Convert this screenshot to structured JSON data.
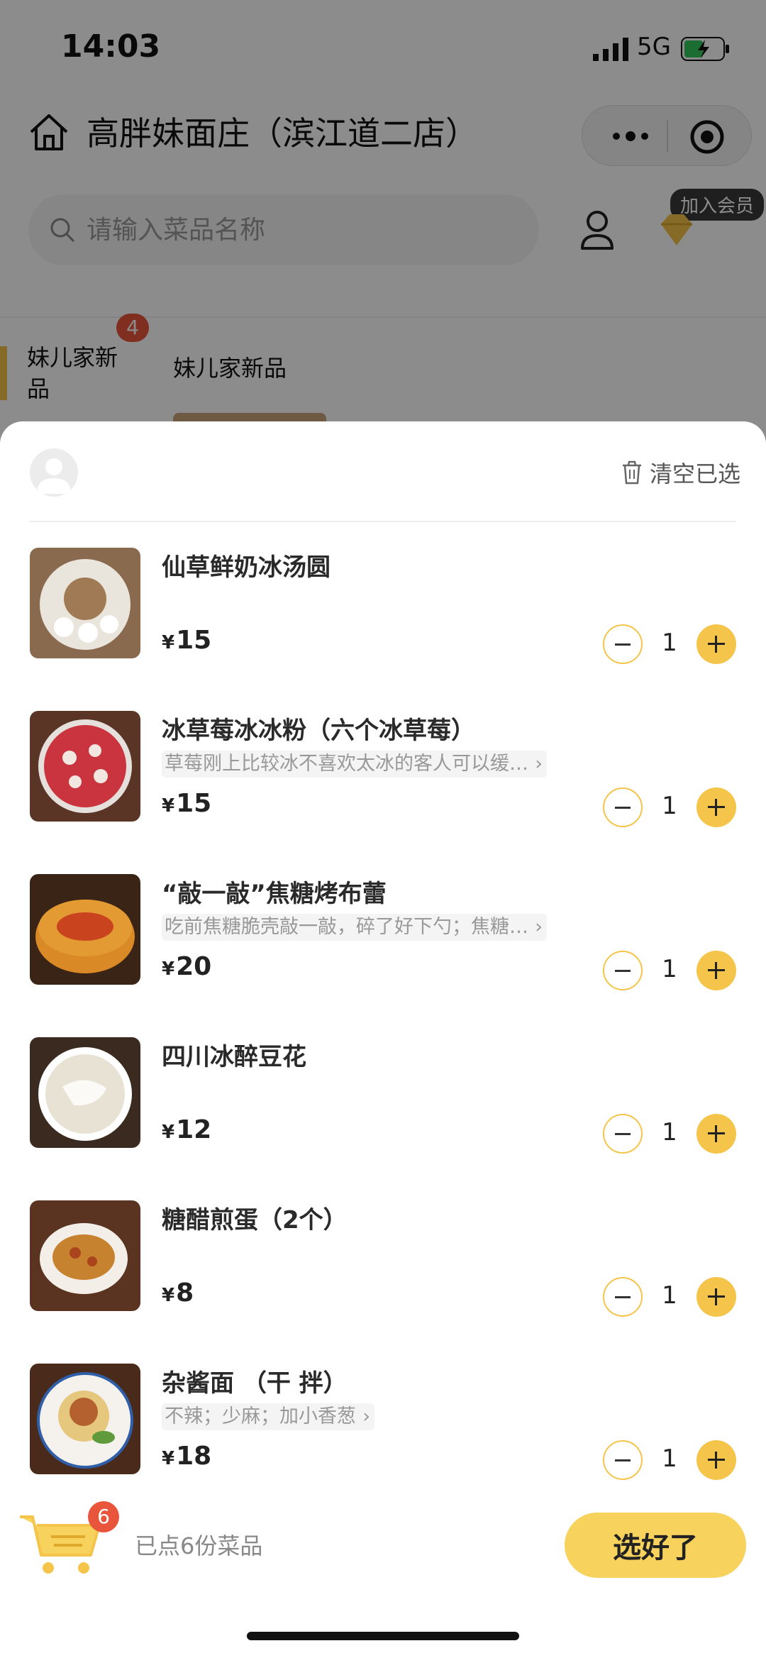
{
  "status_bar": {
    "time": "14:03",
    "network": "5G"
  },
  "header": {
    "store_name": "高胖妹面庄（滨江道二店）"
  },
  "search": {
    "placeholder": "请输入菜品名称"
  },
  "member": {
    "badge_label": "加入会员"
  },
  "category": {
    "side_label": "妹儿家新品",
    "count": "4",
    "title": "妹儿家新品"
  },
  "sheet": {
    "clear_label": "清空已选"
  },
  "items": [
    {
      "name": "仙草鲜奶冰汤圆",
      "note": "",
      "currency": "¥",
      "price": "15",
      "qty": "1",
      "thumb_color": "#8a6a4e"
    },
    {
      "name": "冰草莓冰冰粉（六个冰草莓）",
      "note": "草莓刚上比较冰不喜欢太冰的客人可以缓…",
      "currency": "¥",
      "price": "15",
      "qty": "1",
      "thumb_color": "#c9343e"
    },
    {
      "name": "“敲一敲”焦糖烤布蕾",
      "note": "吃前焦糖脆壳敲一敲，碎了好下勺；焦糖…",
      "currency": "¥",
      "price": "20",
      "qty": "1",
      "thumb_color": "#e39a32"
    },
    {
      "name": "四川冰醉豆花",
      "note": "",
      "currency": "¥",
      "price": "12",
      "qty": "1",
      "thumb_color": "#e8e2d4"
    },
    {
      "name": "糖醋煎蛋（2个）",
      "note": "",
      "currency": "¥",
      "price": "8",
      "qty": "1",
      "thumb_color": "#c7822f"
    },
    {
      "name": "杂酱面 （干 拌）",
      "note": "不辣；少麻；加小香葱",
      "currency": "¥",
      "price": "18",
      "qty": "1",
      "thumb_color": "#b5612f"
    }
  ],
  "cart": {
    "count": "6",
    "summary": "已点6份菜品",
    "submit_label": "选好了"
  },
  "colors": {
    "accent": "#f5c44a",
    "badge": "#e8553b",
    "overlay": "rgba(0,0,0,0.45)"
  }
}
